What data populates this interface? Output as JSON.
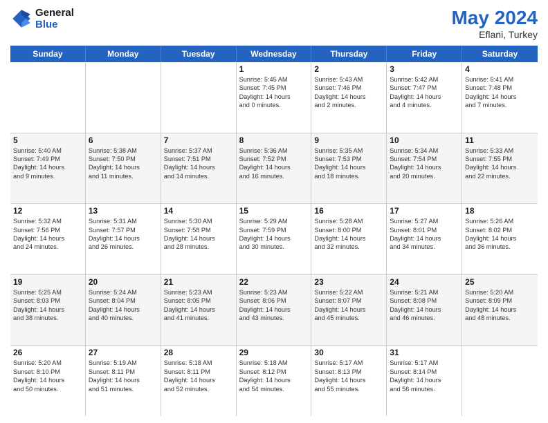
{
  "header": {
    "logo_line1": "General",
    "logo_line2": "Blue",
    "month_year": "May 2024",
    "location": "Eflani, Turkey"
  },
  "weekdays": [
    "Sunday",
    "Monday",
    "Tuesday",
    "Wednesday",
    "Thursday",
    "Friday",
    "Saturday"
  ],
  "rows": [
    [
      {
        "day": "",
        "lines": []
      },
      {
        "day": "",
        "lines": []
      },
      {
        "day": "",
        "lines": []
      },
      {
        "day": "1",
        "lines": [
          "Sunrise: 5:45 AM",
          "Sunset: 7:45 PM",
          "Daylight: 14 hours",
          "and 0 minutes."
        ]
      },
      {
        "day": "2",
        "lines": [
          "Sunrise: 5:43 AM",
          "Sunset: 7:46 PM",
          "Daylight: 14 hours",
          "and 2 minutes."
        ]
      },
      {
        "day": "3",
        "lines": [
          "Sunrise: 5:42 AM",
          "Sunset: 7:47 PM",
          "Daylight: 14 hours",
          "and 4 minutes."
        ]
      },
      {
        "day": "4",
        "lines": [
          "Sunrise: 5:41 AM",
          "Sunset: 7:48 PM",
          "Daylight: 14 hours",
          "and 7 minutes."
        ]
      }
    ],
    [
      {
        "day": "5",
        "lines": [
          "Sunrise: 5:40 AM",
          "Sunset: 7:49 PM",
          "Daylight: 14 hours",
          "and 9 minutes."
        ]
      },
      {
        "day": "6",
        "lines": [
          "Sunrise: 5:38 AM",
          "Sunset: 7:50 PM",
          "Daylight: 14 hours",
          "and 11 minutes."
        ]
      },
      {
        "day": "7",
        "lines": [
          "Sunrise: 5:37 AM",
          "Sunset: 7:51 PM",
          "Daylight: 14 hours",
          "and 14 minutes."
        ]
      },
      {
        "day": "8",
        "lines": [
          "Sunrise: 5:36 AM",
          "Sunset: 7:52 PM",
          "Daylight: 14 hours",
          "and 16 minutes."
        ]
      },
      {
        "day": "9",
        "lines": [
          "Sunrise: 5:35 AM",
          "Sunset: 7:53 PM",
          "Daylight: 14 hours",
          "and 18 minutes."
        ]
      },
      {
        "day": "10",
        "lines": [
          "Sunrise: 5:34 AM",
          "Sunset: 7:54 PM",
          "Daylight: 14 hours",
          "and 20 minutes."
        ]
      },
      {
        "day": "11",
        "lines": [
          "Sunrise: 5:33 AM",
          "Sunset: 7:55 PM",
          "Daylight: 14 hours",
          "and 22 minutes."
        ]
      }
    ],
    [
      {
        "day": "12",
        "lines": [
          "Sunrise: 5:32 AM",
          "Sunset: 7:56 PM",
          "Daylight: 14 hours",
          "and 24 minutes."
        ]
      },
      {
        "day": "13",
        "lines": [
          "Sunrise: 5:31 AM",
          "Sunset: 7:57 PM",
          "Daylight: 14 hours",
          "and 26 minutes."
        ]
      },
      {
        "day": "14",
        "lines": [
          "Sunrise: 5:30 AM",
          "Sunset: 7:58 PM",
          "Daylight: 14 hours",
          "and 28 minutes."
        ]
      },
      {
        "day": "15",
        "lines": [
          "Sunrise: 5:29 AM",
          "Sunset: 7:59 PM",
          "Daylight: 14 hours",
          "and 30 minutes."
        ]
      },
      {
        "day": "16",
        "lines": [
          "Sunrise: 5:28 AM",
          "Sunset: 8:00 PM",
          "Daylight: 14 hours",
          "and 32 minutes."
        ]
      },
      {
        "day": "17",
        "lines": [
          "Sunrise: 5:27 AM",
          "Sunset: 8:01 PM",
          "Daylight: 14 hours",
          "and 34 minutes."
        ]
      },
      {
        "day": "18",
        "lines": [
          "Sunrise: 5:26 AM",
          "Sunset: 8:02 PM",
          "Daylight: 14 hours",
          "and 36 minutes."
        ]
      }
    ],
    [
      {
        "day": "19",
        "lines": [
          "Sunrise: 5:25 AM",
          "Sunset: 8:03 PM",
          "Daylight: 14 hours",
          "and 38 minutes."
        ]
      },
      {
        "day": "20",
        "lines": [
          "Sunrise: 5:24 AM",
          "Sunset: 8:04 PM",
          "Daylight: 14 hours",
          "and 40 minutes."
        ]
      },
      {
        "day": "21",
        "lines": [
          "Sunrise: 5:23 AM",
          "Sunset: 8:05 PM",
          "Daylight: 14 hours",
          "and 41 minutes."
        ]
      },
      {
        "day": "22",
        "lines": [
          "Sunrise: 5:23 AM",
          "Sunset: 8:06 PM",
          "Daylight: 14 hours",
          "and 43 minutes."
        ]
      },
      {
        "day": "23",
        "lines": [
          "Sunrise: 5:22 AM",
          "Sunset: 8:07 PM",
          "Daylight: 14 hours",
          "and 45 minutes."
        ]
      },
      {
        "day": "24",
        "lines": [
          "Sunrise: 5:21 AM",
          "Sunset: 8:08 PM",
          "Daylight: 14 hours",
          "and 46 minutes."
        ]
      },
      {
        "day": "25",
        "lines": [
          "Sunrise: 5:20 AM",
          "Sunset: 8:09 PM",
          "Daylight: 14 hours",
          "and 48 minutes."
        ]
      }
    ],
    [
      {
        "day": "26",
        "lines": [
          "Sunrise: 5:20 AM",
          "Sunset: 8:10 PM",
          "Daylight: 14 hours",
          "and 50 minutes."
        ]
      },
      {
        "day": "27",
        "lines": [
          "Sunrise: 5:19 AM",
          "Sunset: 8:11 PM",
          "Daylight: 14 hours",
          "and 51 minutes."
        ]
      },
      {
        "day": "28",
        "lines": [
          "Sunrise: 5:18 AM",
          "Sunset: 8:11 PM",
          "Daylight: 14 hours",
          "and 52 minutes."
        ]
      },
      {
        "day": "29",
        "lines": [
          "Sunrise: 5:18 AM",
          "Sunset: 8:12 PM",
          "Daylight: 14 hours",
          "and 54 minutes."
        ]
      },
      {
        "day": "30",
        "lines": [
          "Sunrise: 5:17 AM",
          "Sunset: 8:13 PM",
          "Daylight: 14 hours",
          "and 55 minutes."
        ]
      },
      {
        "day": "31",
        "lines": [
          "Sunrise: 5:17 AM",
          "Sunset: 8:14 PM",
          "Daylight: 14 hours",
          "and 56 minutes."
        ]
      },
      {
        "day": "",
        "lines": []
      }
    ]
  ]
}
